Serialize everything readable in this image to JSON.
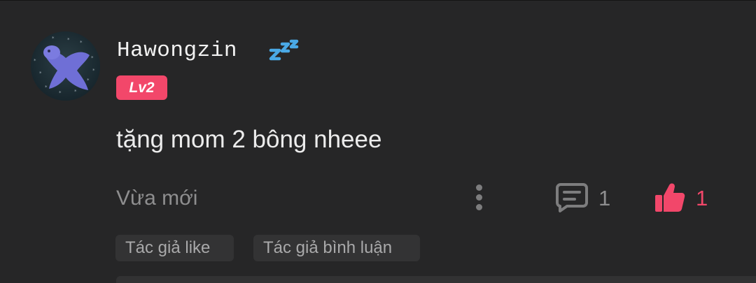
{
  "comment": {
    "username": "Hawongzin",
    "status_icon": "zzz-sleep-icon",
    "level_badge": "Lv2",
    "text": "tặng mom 2 bông nheee",
    "timestamp": "Vừa mới",
    "reply_count": "1",
    "like_count": "1",
    "liked": true
  },
  "tags": {
    "author_like": "Tác giả like",
    "author_comment": "Tác giả bình luận"
  },
  "icons": {
    "more": "more-vertical-icon",
    "reply": "comment-icon",
    "like": "thumbs-up-icon"
  },
  "colors": {
    "background": "#262627",
    "accent": "#f2476a",
    "muted_text": "#8e8e8f",
    "zzz_icon": "#4aa9e6"
  }
}
